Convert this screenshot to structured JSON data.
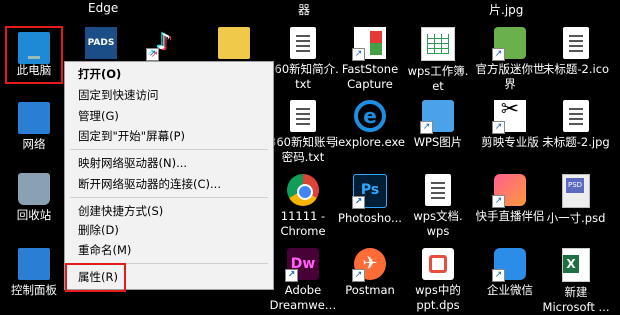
{
  "top_labels": {
    "edge": "Edge",
    "qi": "器",
    "jpg": "片.jpg"
  },
  "icons": {
    "this_pc": "此电脑",
    "network": "网络",
    "recycle_bin": "回收站",
    "control_panel": "控制面板",
    "pads": "",
    "tiktok": "",
    "folder": "",
    "doc_360_intro": "360新知简介.\ntxt",
    "doc_360_account": "360新知账号\n密码.txt",
    "chrome": "11111 -\nChrome",
    "dreamweaver": "Adobe\nDreamwe…",
    "faststone": "FastStone\nCapture",
    "iexplore": "iexplore.exe",
    "photoshop": "Photosho...",
    "postman": "Postman",
    "wps_workbook": "wps工作簿.\net",
    "wps_pics": "WPS图片",
    "wps_doc": "wps文档.\nwps",
    "wps_ppt": "wps中的\nppt.dps",
    "official_game": "官方版迷你世\n界",
    "capcut": "剪映专业版",
    "kuaishou": "快手直播伴侣",
    "wecom": "企业微信",
    "untitled_ico": "未标题-2.ico",
    "untitled_jpg": "未标题-2.jpg",
    "psd_file": "小一寸.psd",
    "xlsx_file": "新建\nMicrosoft ..."
  },
  "context_menu": {
    "open": "打开(O)",
    "pin_quick_access": "固定到快速访问",
    "manage": "管理(G)",
    "pin_start": "固定到\"开始\"屏幕(P)",
    "map_drive": "映射网络驱动器(N)...",
    "disconnect_drive": "断开网络驱动器的连接(C)...",
    "create_shortcut": "创建快捷方式(S)",
    "delete": "删除(D)",
    "rename": "重命名(M)",
    "properties": "属性(R)"
  },
  "colors": {
    "highlight": "#e31b1b",
    "menu_bg": "#f2f2f2",
    "desktop_bg": "#000000"
  }
}
